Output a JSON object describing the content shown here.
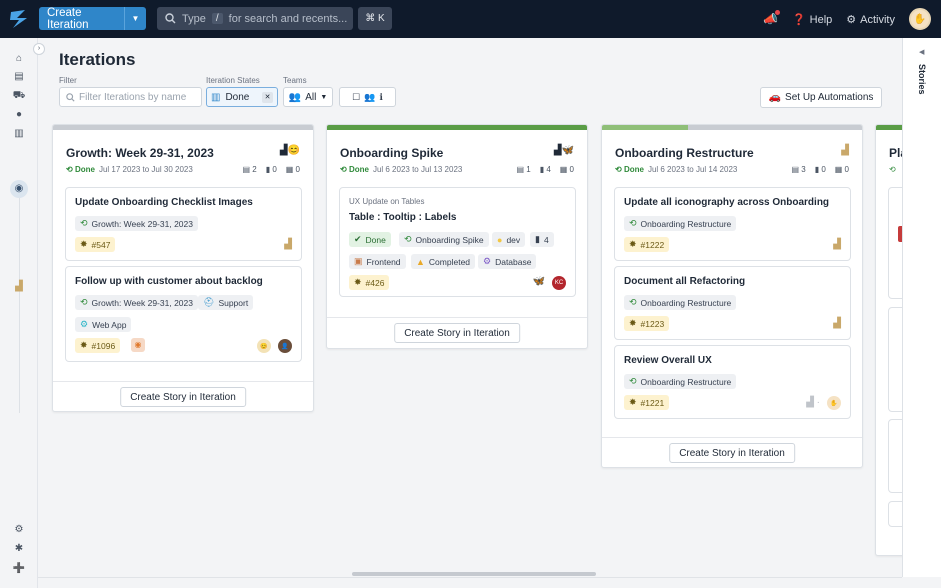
{
  "header": {
    "create_label": "Create Iteration",
    "search_placeholder_pre": "Type",
    "search_key": "/",
    "search_placeholder_post": "for search and recents...",
    "shortcut": "⌘ K",
    "help": "Help",
    "activity": "Activity"
  },
  "page": {
    "title": "Iterations",
    "filter_label": "Filter",
    "filter_placeholder": "Filter Iterations by name",
    "states_label": "Iteration States",
    "states_value": "Done",
    "teams_label": "Teams",
    "teams_value": "All",
    "automations": "Set Up Automations",
    "stories_tab": "Stories"
  },
  "columns": [
    {
      "title": "Growth: Week 29-31, 2023",
      "status": "Done",
      "dates": "Jul 17 2023 to Jul 30 2023",
      "stats": [
        "2",
        "0",
        "0"
      ],
      "create": "Create Story in Iteration",
      "color": "#c8ccd2",
      "cards": [
        {
          "title": "Update Onboarding Checklist Images",
          "iteration": "Growth: Week 29-31, 2023",
          "id": "#547"
        },
        {
          "title": "Follow up with customer about backlog",
          "iteration": "Growth: Week 29-31, 2023",
          "label1": "Support",
          "label2": "Web App",
          "id": "#1096"
        }
      ]
    },
    {
      "title": "Onboarding Spike",
      "status": "Done",
      "dates": "Jul 6 2023 to Jul 13 2023",
      "stats": [
        "1",
        "4",
        "0"
      ],
      "create": "Create Story in Iteration",
      "color": "#5a9d46",
      "cards": [
        {
          "epic": "UX Update on Tables",
          "title": "Table : Tooltip : Labels",
          "state": "Done",
          "iteration": "Onboarding Spike",
          "label": "dev",
          "estimate": "4",
          "label2": "Frontend",
          "label3": "Completed",
          "label4": "Database",
          "id": "#426",
          "owner": "KC"
        }
      ]
    },
    {
      "title": "Onboarding Restructure",
      "status": "Done",
      "dates": "Jul 6 2023 to Jul 14 2023",
      "stats": [
        "3",
        "0",
        "0"
      ],
      "create": "Create Story in Iteration",
      "color": "#c8ccd2",
      "color2": "#8fbf78",
      "cards": [
        {
          "title": "Update all iconography across Onboarding",
          "iteration": "Onboarding Restructure",
          "id": "#1222"
        },
        {
          "title": "Document all Refactoring",
          "iteration": "Onboarding Restructure",
          "id": "#1223"
        },
        {
          "title": "Review Overall UX",
          "iteration": "Onboarding Restructure",
          "id": "#1221"
        }
      ]
    },
    {
      "title": "Pla",
      "status": "",
      "color": "#5a9d46"
    }
  ]
}
